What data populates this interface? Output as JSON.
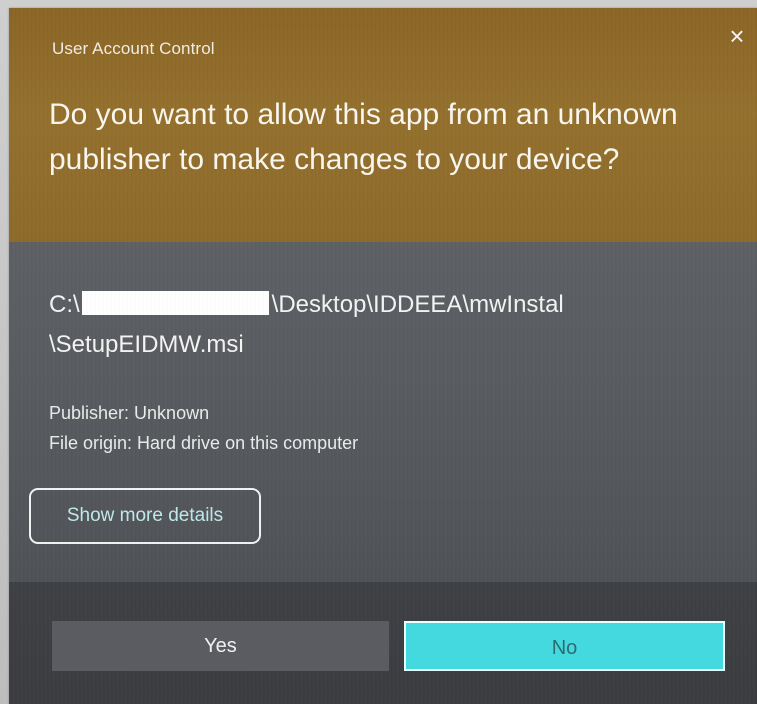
{
  "dialog": {
    "title": "User Account Control",
    "close_glyph": "×",
    "question": "Do you want to allow this app from an unknown publisher to make changes to your device?",
    "path": {
      "prefix": "C:\\",
      "suffix": "\\Desktop\\IDDEEA\\mwInstal",
      "line2": "\\SetupEIDMW.msi"
    },
    "publisher": "Publisher: Unknown",
    "file_origin": "File origin: Hard drive on this computer",
    "details_button": "Show more details",
    "yes_button": "Yes",
    "no_button": "No"
  },
  "colors": {
    "header": "#8d6a2a",
    "body": "#575a5e",
    "footer": "#3c3e42",
    "accent": "#43d9de"
  },
  "icons": {
    "close": "close-icon"
  }
}
